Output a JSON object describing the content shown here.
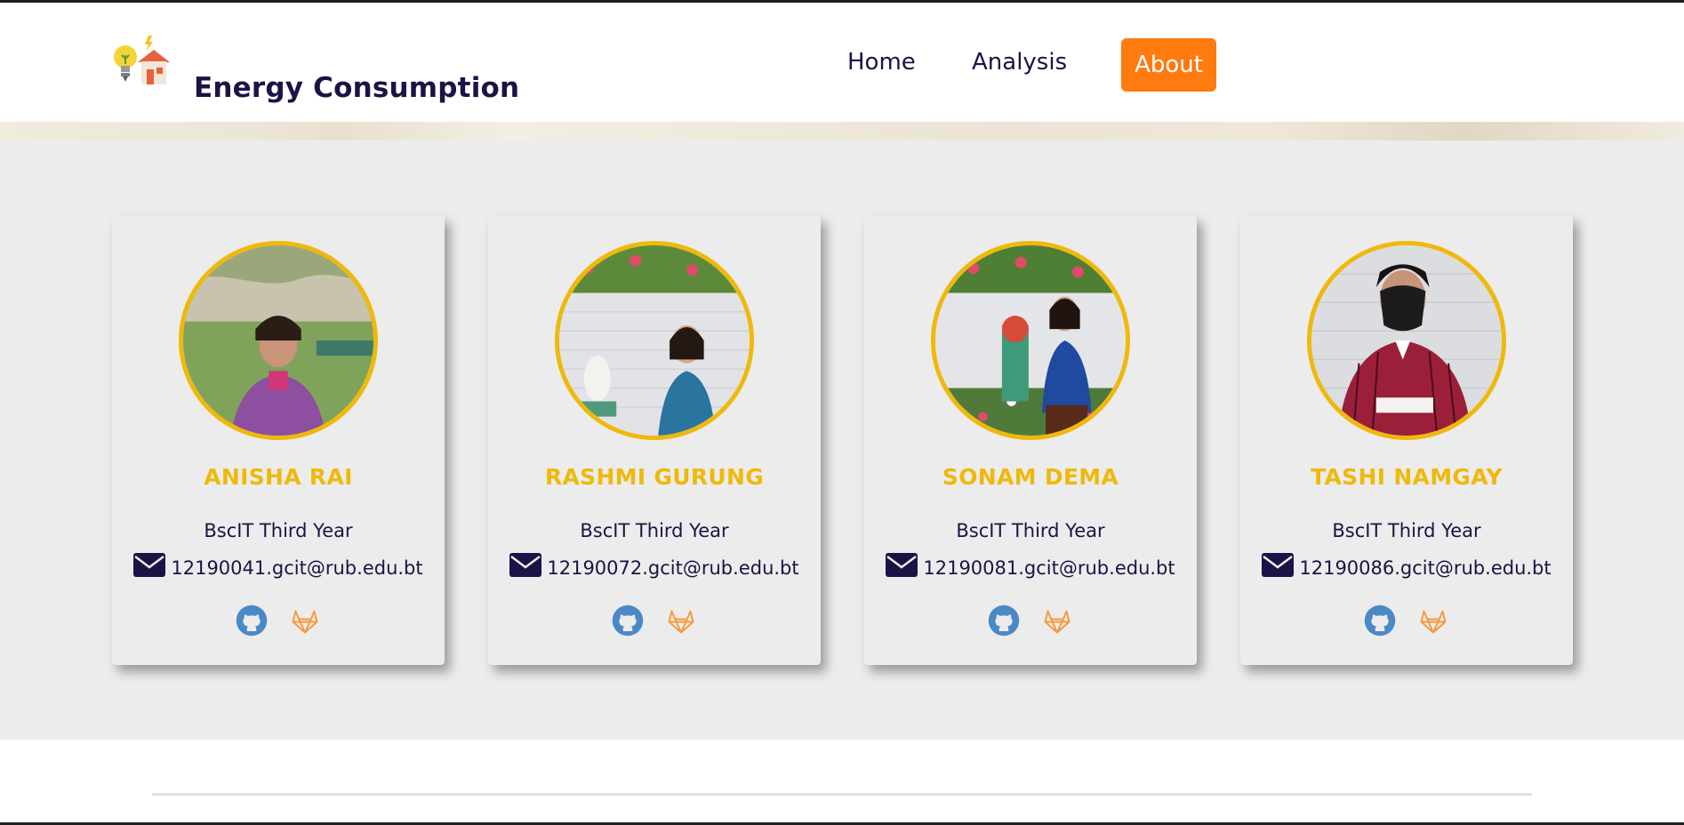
{
  "brand": {
    "title": "Energy Consumption",
    "logo_icon": "energy-house-bulb-icon"
  },
  "nav": {
    "home": "Home",
    "analysis": "Analysis",
    "about": "About",
    "active": "About",
    "accent_color": "#ff7a0f"
  },
  "colors": {
    "name_color": "#efb90c",
    "text_color": "#1a1446",
    "github_color": "#4a89c8",
    "gitlab_color": "#f59a3a"
  },
  "team": [
    {
      "name": "ANISHA RAI",
      "year": "BscIT Third Year",
      "email": "12190041.gcit@rub.edu.bt",
      "icons": [
        "envelope-icon",
        "github-icon",
        "gitlab-icon"
      ]
    },
    {
      "name": "RASHMI GURUNG",
      "year": "BscIT Third Year",
      "email": "12190072.gcit@rub.edu.bt",
      "icons": [
        "envelope-icon",
        "github-icon",
        "gitlab-icon"
      ]
    },
    {
      "name": "SONAM DEMA",
      "year": "BscIT Third Year",
      "email": "12190081.gcit@rub.edu.bt",
      "icons": [
        "envelope-icon",
        "github-icon",
        "gitlab-icon"
      ]
    },
    {
      "name": "TASHI NAMGAY",
      "year": "BscIT Third Year",
      "email": "12190086.gcit@rub.edu.bt",
      "icons": [
        "envelope-icon",
        "github-icon",
        "gitlab-icon"
      ]
    }
  ]
}
